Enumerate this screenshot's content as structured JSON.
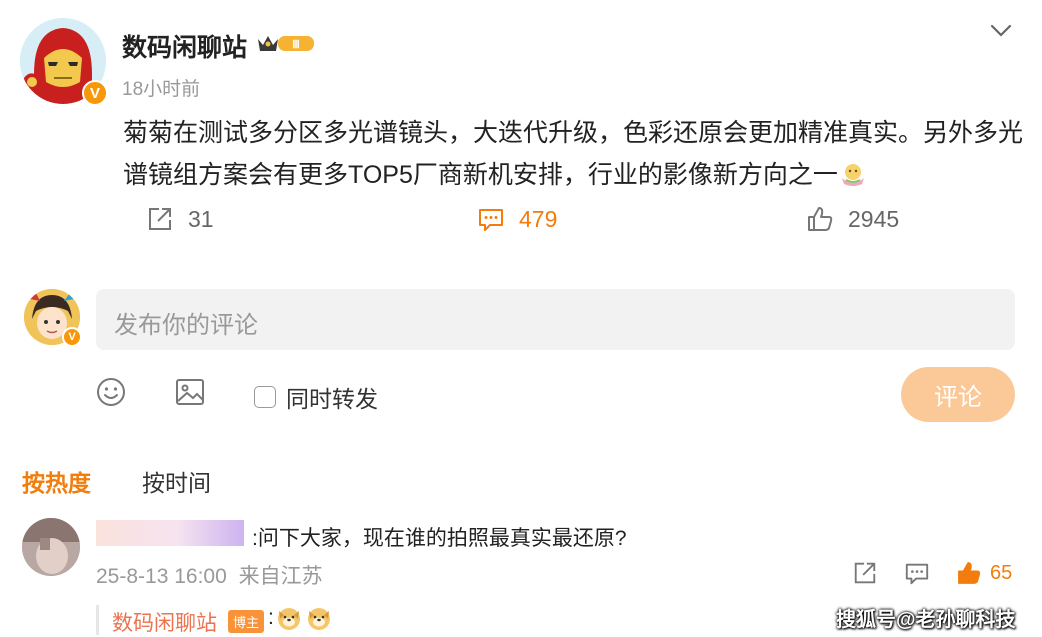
{
  "post": {
    "author": "数码闲聊站",
    "level_badge": "Ⅲ",
    "time": "18小时前",
    "text": "菊菊在测试多分区多光谱镜头，大迭代升级，色彩还原会更加精准真实。另外多光谱镜组方案会有更多TOP5厂商新机安排，行业的影像新方向之一",
    "emoji": "flower-emoji",
    "verified_mark": "V"
  },
  "actions": {
    "share_count": "31",
    "comment_count": "479",
    "like_count": "2945"
  },
  "composer": {
    "placeholder": "发布你的评论",
    "repost_label": "同时转发",
    "submit_label": "评论"
  },
  "sort": {
    "hot": "按热度",
    "time": "按时间"
  },
  "comment": {
    "text": ":问下大家，现在谁的拍照最真实最还原?",
    "date": "25-8-13 16:00",
    "location": "来自江苏",
    "like_count": "65"
  },
  "reply": {
    "author": "数码闲聊站",
    "badge": "博主",
    "colon": ":"
  },
  "watermark": "搜狐号@老孙聊科技",
  "colors": {
    "accent": "#f27d0c",
    "reply_name": "#eb7350",
    "submit_bg": "#fbc997"
  }
}
